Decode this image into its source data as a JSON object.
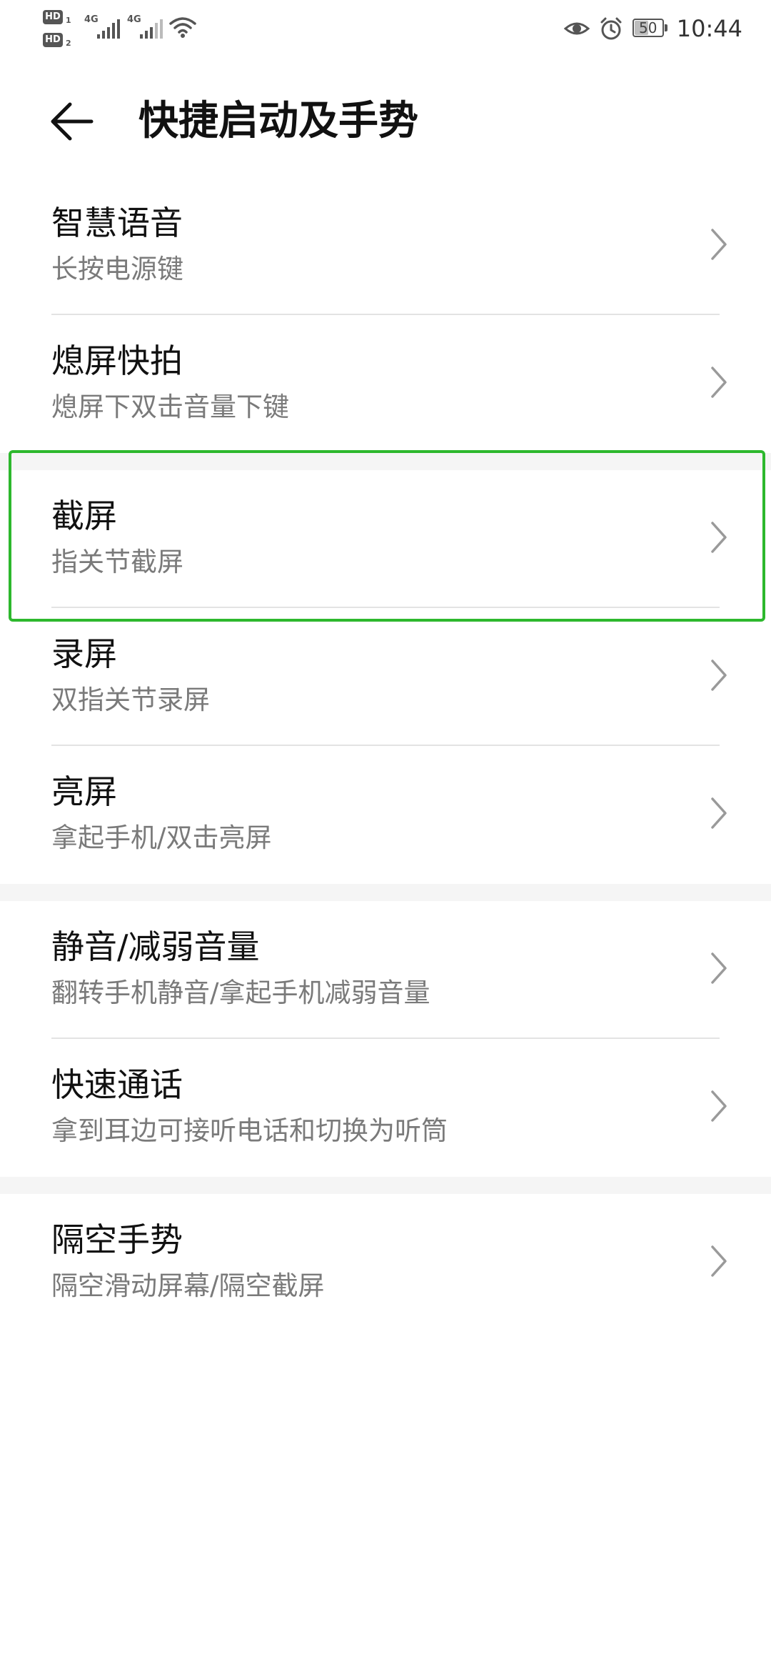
{
  "status_bar": {
    "sim1_badge": "HD",
    "sim1_index": "1",
    "sim2_badge": "HD",
    "sim2_index": "2",
    "network1": "4G",
    "network2": "4G",
    "battery_level": "50",
    "time": "10:44",
    "icons": [
      "eye-icon",
      "alarm-icon",
      "wifi-icon",
      "signal-icon"
    ]
  },
  "header": {
    "back_icon": "back-arrow-icon",
    "title": "快捷启动及手势"
  },
  "groups": [
    {
      "items": [
        {
          "title": "智慧语音",
          "subtitle": "长按电源键"
        },
        {
          "title": "熄屏快拍",
          "subtitle": "熄屏下双击音量下键"
        }
      ]
    },
    {
      "items": [
        {
          "title": "截屏",
          "subtitle": "指关节截屏"
        },
        {
          "title": "录屏",
          "subtitle": "双指关节录屏"
        },
        {
          "title": "亮屏",
          "subtitle": "拿起手机/双击亮屏"
        }
      ]
    },
    {
      "items": [
        {
          "title": "静音/减弱音量",
          "subtitle": "翻转手机静音/拿起手机减弱音量"
        },
        {
          "title": "快速通话",
          "subtitle": "拿到耳边可接听电话和切换为听筒"
        }
      ]
    },
    {
      "items": [
        {
          "title": "隔空手势",
          "subtitle": "隔空滑动屏幕/隔空截屏"
        }
      ]
    }
  ],
  "colors": {
    "highlight": "#2db82d",
    "subtitle": "#7a7a7a",
    "divider": "#e3e3e3",
    "group_gap": "#f5f5f5"
  }
}
